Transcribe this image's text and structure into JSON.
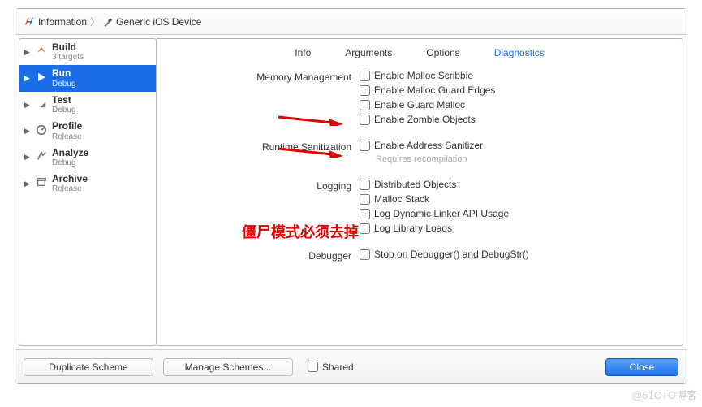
{
  "breadcrumb": {
    "item1": "Information",
    "item2": "Generic iOS Device"
  },
  "sidebar": {
    "items": [
      {
        "title": "Build",
        "subtitle": "3 targets"
      },
      {
        "title": "Run",
        "subtitle": "Debug"
      },
      {
        "title": "Test",
        "subtitle": "Debug"
      },
      {
        "title": "Profile",
        "subtitle": "Release"
      },
      {
        "title": "Analyze",
        "subtitle": "Debug"
      },
      {
        "title": "Archive",
        "subtitle": "Release"
      }
    ]
  },
  "tabs": {
    "info": "Info",
    "arguments": "Arguments",
    "options": "Options",
    "diagnostics": "Diagnostics"
  },
  "sections": {
    "memory": {
      "label": "Memory Management",
      "opts": [
        "Enable Malloc Scribble",
        "Enable Malloc Guard Edges",
        "Enable Guard Malloc",
        "Enable Zombie Objects"
      ]
    },
    "runtime": {
      "label": "Runtime Sanitization",
      "opt": "Enable Address Sanitizer",
      "note": "Requires recompilation"
    },
    "logging": {
      "label": "Logging",
      "opts": [
        "Distributed Objects",
        "Malloc Stack",
        "Log Dynamic Linker API Usage",
        "Log Library Loads"
      ]
    },
    "debugger": {
      "label": "Debugger",
      "opt": "Stop on Debugger() and DebugStr()"
    }
  },
  "bottom": {
    "duplicate": "Duplicate Scheme",
    "manage": "Manage Schemes...",
    "shared": "Shared",
    "close": "Close"
  },
  "annotation": "僵尸模式必须去掉",
  "watermark": "@51CTO博客"
}
